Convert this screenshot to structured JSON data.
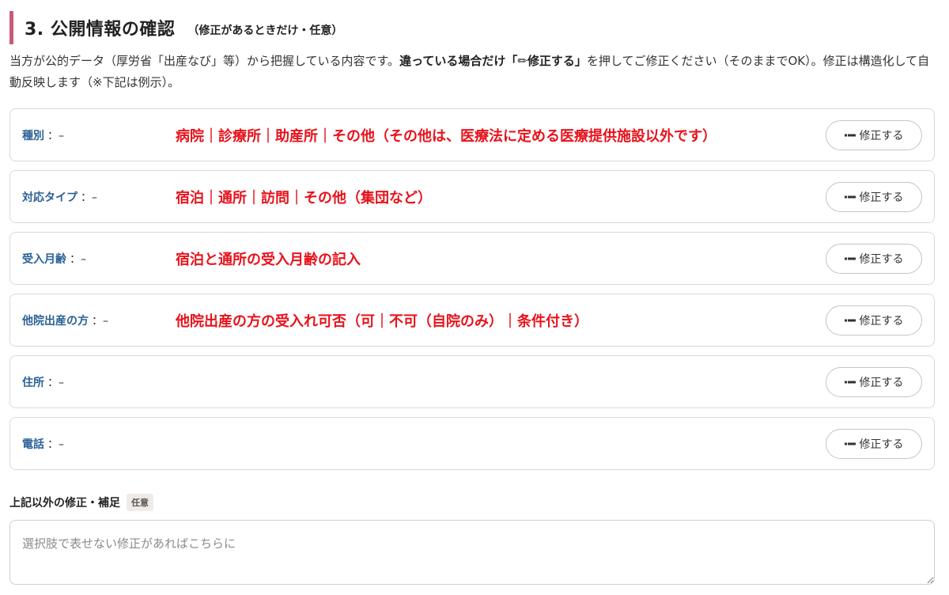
{
  "section": {
    "title": "3. 公開情報の確認",
    "note": "（修正があるときだけ・任意）",
    "accent_color": "#c85a74"
  },
  "intro": {
    "text_1": "当方が公的データ（厚労省「出産なび」等）から把握している内容です。",
    "text_bold": "違っている場合だけ「✏修正する」",
    "text_2": "を押してご修正ください（そのままでOK）。修正は構造化して自動反映します（※下記は例示）。"
  },
  "rows": [
    {
      "label": "種別",
      "value": "：–",
      "annotation": "病院｜診療所｜助産所｜その他（その他は、医療法に定める医療提供施設以外です）",
      "button": "修正する"
    },
    {
      "label": "対応タイプ",
      "value": "：–",
      "annotation": "宿泊｜通所｜訪問｜その他（集団など）",
      "button": "修正する"
    },
    {
      "label": "受入月齢",
      "value": "：–",
      "annotation": "宿泊と通所の受入月齢の記入",
      "button": "修正する"
    },
    {
      "label": "他院出産の方",
      "value": "：–",
      "annotation": "他院出産の方の受入れ可否（可｜不可（自院のみ）｜条件付き）",
      "button": "修正する"
    },
    {
      "label": "住所",
      "value": "：–",
      "annotation": "",
      "button": "修正する"
    },
    {
      "label": "電話",
      "value": "：–",
      "annotation": "",
      "button": "修正する"
    }
  ],
  "extra": {
    "label": "上記以外の修正・補足",
    "badge": "任意",
    "placeholder": "選択肢で表せない修正があればこちらに"
  },
  "colors": {
    "label_blue": "#2b6196",
    "annotation_red": "#e8121b"
  },
  "icons": {
    "edit_button": "pencil-icon"
  }
}
